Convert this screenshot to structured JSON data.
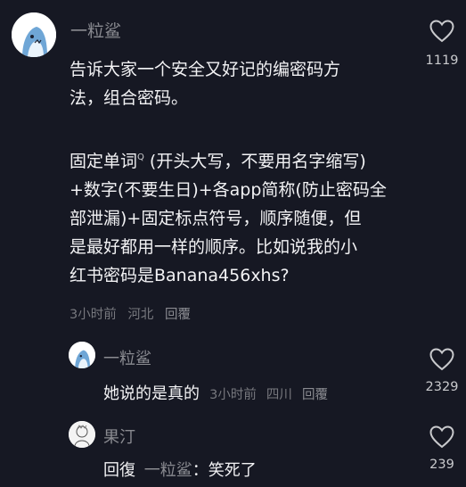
{
  "main_comment": {
    "username": "一粒鲨",
    "lines": [
      "告诉大家一个安全又好记的编密码方",
      "法，组合密码。",
      "",
      "固定单词",
      "+数字(不要生日)+各app简称(防止密码全",
      "部泄漏)+固定标点符号，顺序随便，但",
      "是最好都用一样的顺序。比如说我的小",
      "红书密码是Banana456xhs?"
    ],
    "line4_suffix": " (开头大写，不要用名字缩写)",
    "search_hint": "Q",
    "time": "3小时前",
    "location": "河北",
    "reply_label": "回覆",
    "likes": "1119"
  },
  "replies": [
    {
      "username": "一粒鲨",
      "text": "她说的是真的",
      "time": "3小时前",
      "location": "四川",
      "reply_label": "回覆",
      "likes": "2329"
    },
    {
      "username": "果汀",
      "prefix": "回復",
      "mention": "一粒鲨",
      "text": "：笑死了",
      "likes": "239"
    }
  ]
}
